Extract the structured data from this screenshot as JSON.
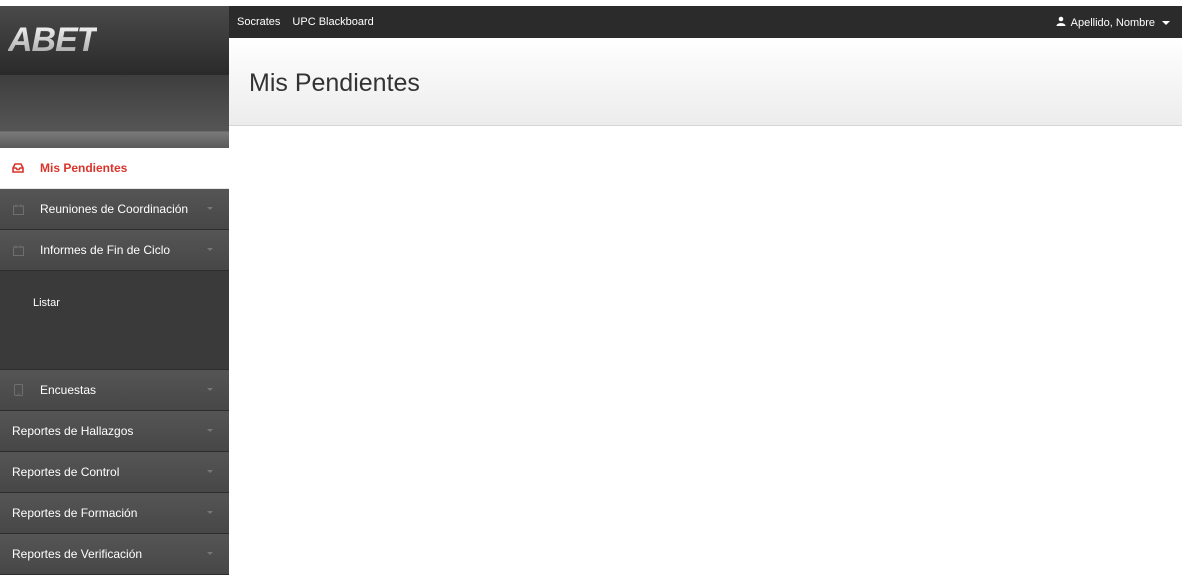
{
  "brand": {
    "logo_text": "ABET"
  },
  "topbar": {
    "links": [
      "Socrates",
      "UPC Blackboard"
    ],
    "user_name": "Apellido, Nombre"
  },
  "page": {
    "title": "Mis Pendientes"
  },
  "sidebar": {
    "items": [
      {
        "label": "Mis Pendientes",
        "icon": "inbox-icon",
        "active": true
      },
      {
        "label": "Reuniones de Coordinación",
        "icon": "calendar-icon",
        "caret": true
      },
      {
        "label": "Informes de Fin de Ciclo",
        "icon": "calendar-icon",
        "caret": true
      },
      {
        "label": "Encuestas",
        "icon": "tablet-icon",
        "caret": true
      },
      {
        "label": "Reportes de Hallazgos",
        "caret": true
      },
      {
        "label": "Reportes de Control",
        "caret": true
      },
      {
        "label": "Reportes de Formación",
        "caret": true
      },
      {
        "label": "Reportes de Verificación",
        "caret": true
      }
    ],
    "submenu": {
      "label": "Listar"
    }
  },
  "colors": {
    "active": "#d9342b",
    "topbar": "#2b2b2b",
    "sidebar": "#474747"
  }
}
